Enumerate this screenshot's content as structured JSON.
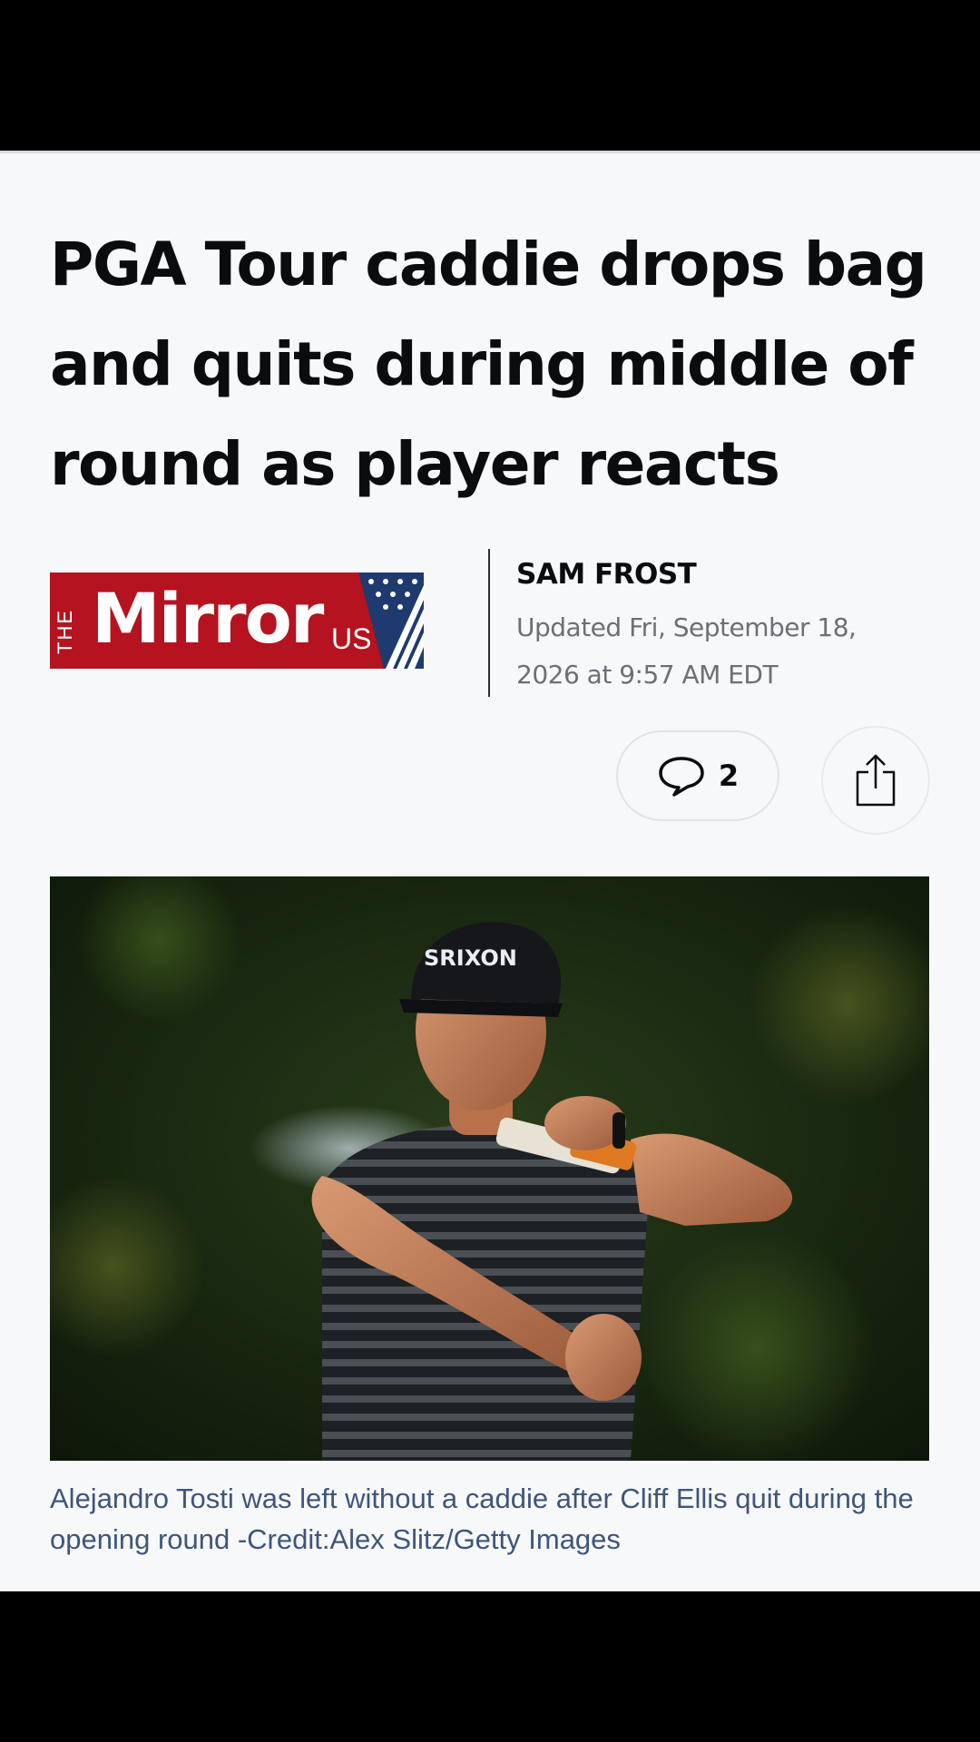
{
  "article": {
    "headline": "PGA Tour caddie drops bag and quits during middle of round as player reacts",
    "publication": {
      "logo_prefix": "THE",
      "logo_word": "Mirror",
      "logo_suffix": "US",
      "brand_color": "#b4131f"
    },
    "author": "SAM FROST",
    "updated": "Updated Fri, September 18, 2026 at 9:57 AM EDT",
    "actions": {
      "comment_count": "2",
      "comment_icon": "speech-bubble-icon",
      "share_icon": "share-icon"
    },
    "image": {
      "description_icon": "golfer-photo"
    },
    "caption": "Alejandro Tosti was left without a caddie after Cliff Ellis quit during the opening round -Credit:Alex Slitz/Getty Images",
    "photo_cap_text": "SRIXON"
  }
}
